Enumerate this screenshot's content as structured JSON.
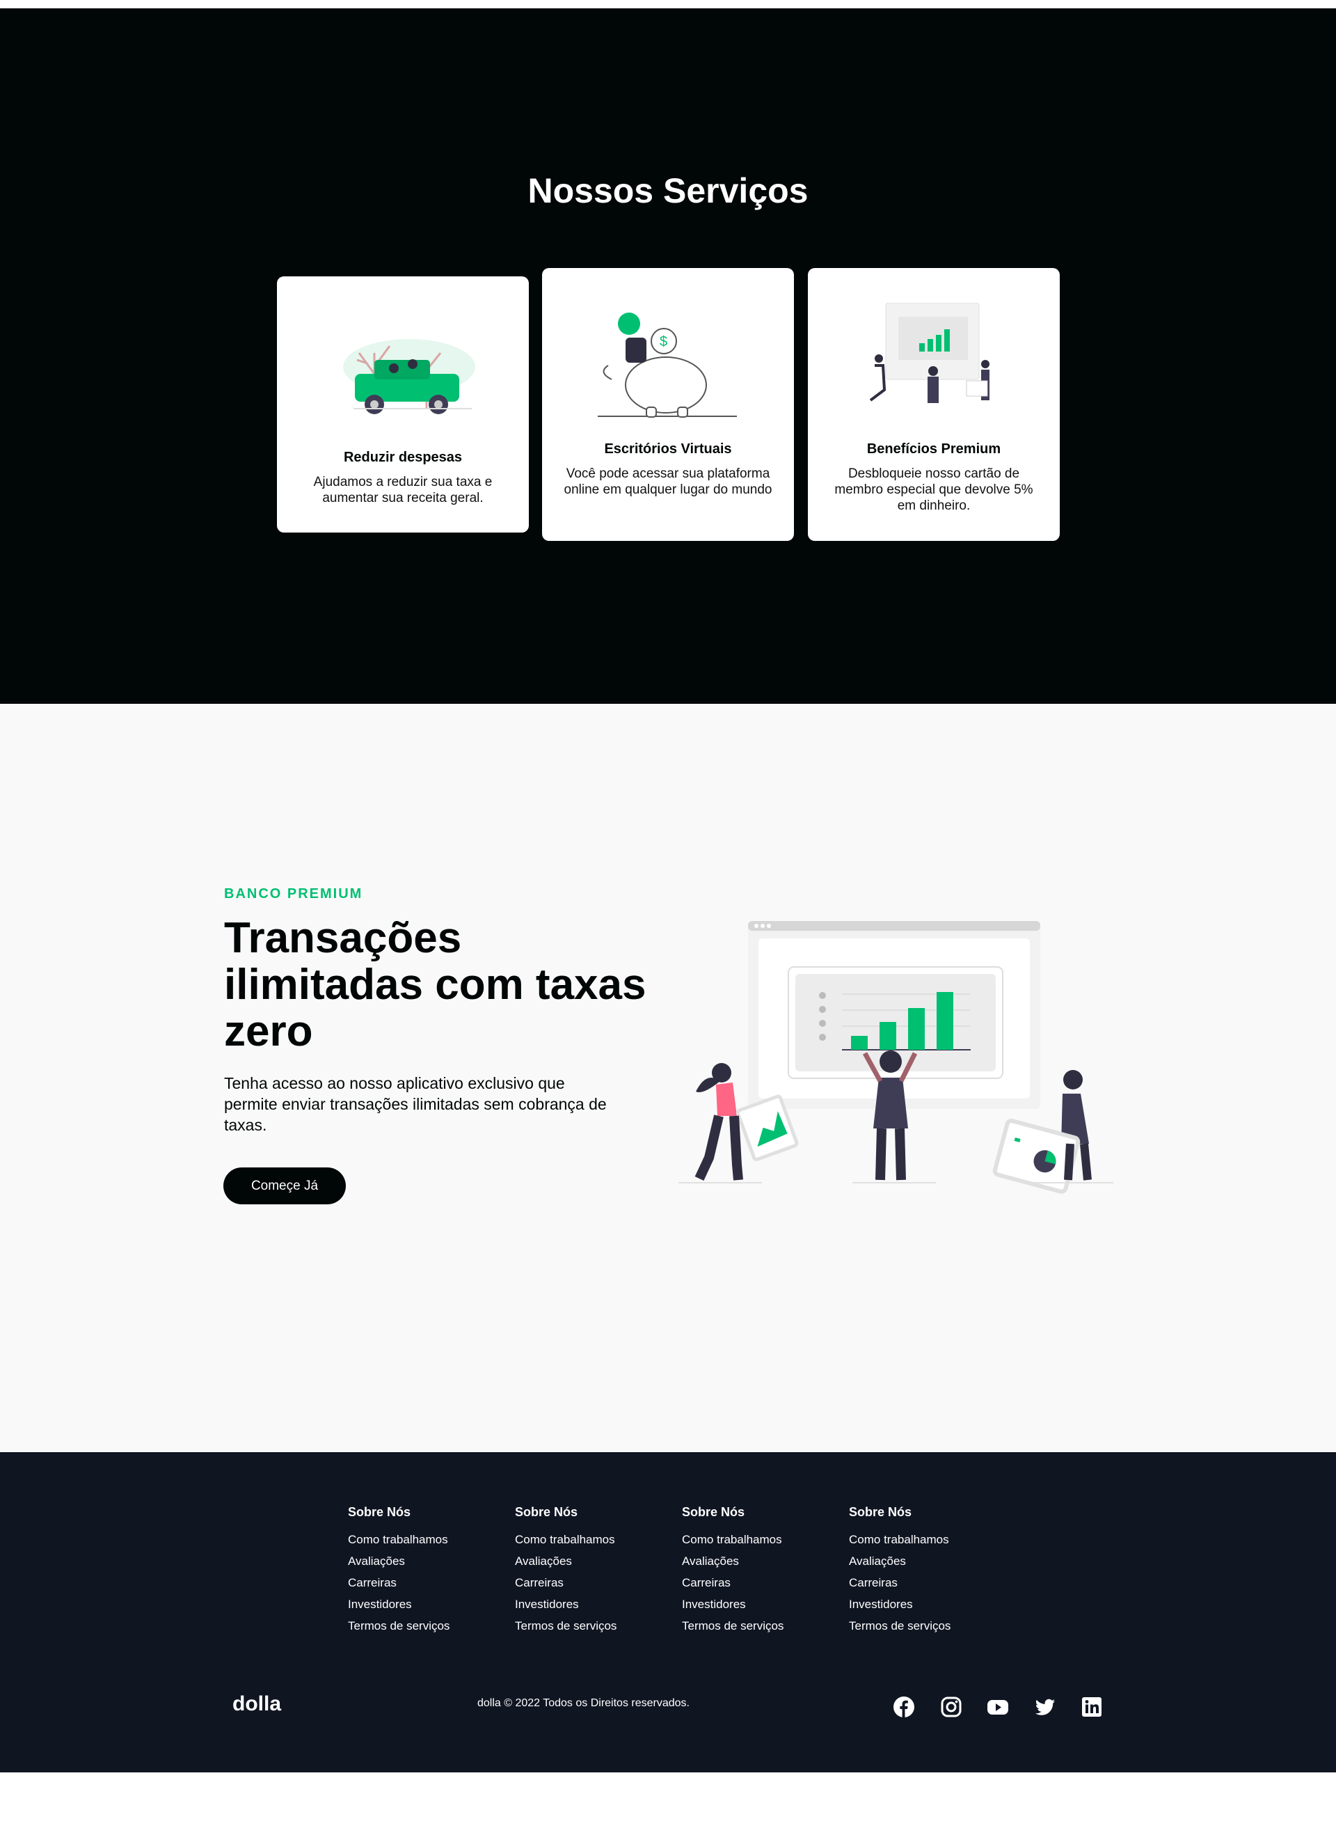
{
  "services": {
    "title": "Nossos Serviços",
    "cards": [
      {
        "title": "Reduzir despesas",
        "description": "Ajudamos a reduzir sua taxa e aumentar sua receita geral."
      },
      {
        "title": "Escritórios Virtuais",
        "description": "Você pode acessar sua plataforma online em qualquer lugar do mundo"
      },
      {
        "title": "Benefícios Premium",
        "description": "Desbloqueie nosso cartão de membro especial que devolve 5% em dinheiro."
      }
    ]
  },
  "info": {
    "topline": "BANCO PREMIUM",
    "headline": "Transações ilimitadas com taxas zero",
    "subtitle": "Tenha acesso ao nosso aplicativo exclusivo que permite enviar transações ilimitadas sem cobrança de taxas.",
    "button_label": "Começe Já"
  },
  "footer": {
    "columns": [
      {
        "title": "Sobre Nós",
        "links": [
          "Como trabalhamos",
          "Avaliações",
          "Carreiras",
          "Investidores",
          "Termos de serviços"
        ]
      },
      {
        "title": "Sobre Nós",
        "links": [
          "Como trabalhamos",
          "Avaliações",
          "Carreiras",
          "Investidores",
          "Termos de serviços"
        ]
      },
      {
        "title": "Sobre Nós",
        "links": [
          "Como trabalhamos",
          "Avaliações",
          "Carreiras",
          "Investidores",
          "Termos de serviços"
        ]
      },
      {
        "title": "Sobre Nós",
        "links": [
          "Como trabalhamos",
          "Avaliações",
          "Carreiras",
          "Investidores",
          "Termos de serviços"
        ]
      }
    ],
    "logo": "dolla",
    "copyright": "dolla © 2022 Todos os Direitos reservados.",
    "social_icons": [
      "facebook-icon",
      "instagram-icon",
      "youtube-icon",
      "twitter-icon",
      "linkedin-icon"
    ]
  },
  "colors": {
    "accent": "#01bf71",
    "dark": "#010606",
    "footer_bg": "#101522",
    "section_bg": "#f9f9f9"
  }
}
